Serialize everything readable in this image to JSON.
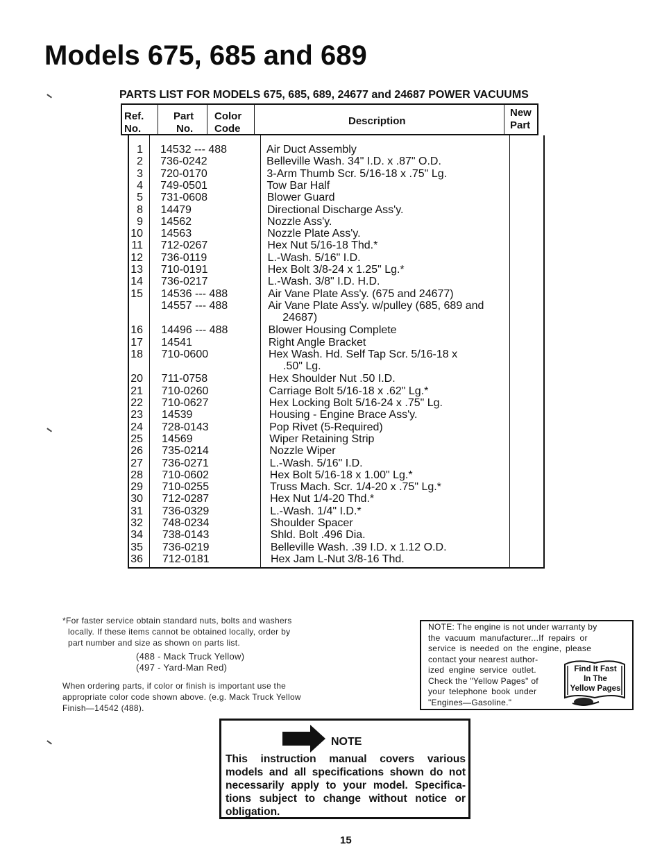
{
  "page": {
    "title": "Models 675, 685 and 689",
    "subtitle": "PARTS LIST FOR MODELS 675, 685, 689, 24677 and 24687 POWER VACUUMS",
    "page_number": "15"
  },
  "table": {
    "headers": {
      "ref": "Ref.\nNo.",
      "ref_line1": "Ref.",
      "ref_line2": "No.",
      "part_line1": "Part",
      "part_line2": "No.",
      "color_line1": "Color",
      "color_line2": "Code",
      "description": "Description",
      "new_line1": "New",
      "new_line2": "Part"
    },
    "rows": [
      {
        "ref": "1",
        "part": "14532 --- 488",
        "desc": "Air Duct Assembly"
      },
      {
        "ref": "2",
        "part": "736-0242",
        "desc": "Belleville Wash. 34\" I.D. x .87\" O.D."
      },
      {
        "ref": "3",
        "part": "720-0170",
        "desc": "3-Arm Thumb Scr. 5/16-18 x .75\" Lg."
      },
      {
        "ref": "4",
        "part": "749-0501",
        "desc": "Tow Bar Half"
      },
      {
        "ref": "5",
        "part": "731-0608",
        "desc": "Blower Guard"
      },
      {
        "ref": "8",
        "part": "14479",
        "desc": "Directional Discharge Ass'y."
      },
      {
        "ref": "9",
        "part": "14562",
        "desc": "Nozzle Ass'y."
      },
      {
        "ref": "10",
        "part": "14563",
        "desc": "Nozzle Plate Ass'y."
      },
      {
        "ref": "11",
        "part": "712-0267",
        "desc": "Hex Nut 5/16-18 Thd.*"
      },
      {
        "ref": "12",
        "part": "736-0119",
        "desc": "L.-Wash. 5/16\" I.D."
      },
      {
        "ref": "13",
        "part": "710-0191",
        "desc": "Hex Bolt 3/8-24 x 1.25\" Lg.*"
      },
      {
        "ref": "14",
        "part": "736-0217",
        "desc": "L.-Wash. 3/8\" I.D. H.D."
      },
      {
        "ref": "15",
        "part": "14536 --- 488",
        "desc": "Air Vane Plate Ass'y. (675 and 24677)"
      },
      {
        "ref": "",
        "part": "14557 --- 488",
        "desc": "Air Vane Plate Ass'y. w/pulley (685, 689 and",
        "desc_cont": "24687)"
      },
      {
        "ref": "16",
        "part": "14496 --- 488",
        "desc": "Blower Housing Complete"
      },
      {
        "ref": "17",
        "part": "14541",
        "desc": "Right Angle Bracket"
      },
      {
        "ref": "18",
        "part": "710-0600",
        "desc": "Hex Wash. Hd. Self Tap Scr. 5/16-18 x",
        "desc_cont": ".50\" Lg."
      },
      {
        "ref": "20",
        "part": "711-0758",
        "desc": "Hex Shoulder Nut .50 I.D."
      },
      {
        "ref": "21",
        "part": "710-0260",
        "desc": "Carriage Bolt 5/16-18 x .62\" Lg.*"
      },
      {
        "ref": "22",
        "part": "710-0627",
        "desc": "Hex Locking Bolt 5/16-24 x .75\" Lg."
      },
      {
        "ref": "23",
        "part": "14539",
        "desc": "Housing - Engine Brace Ass'y."
      },
      {
        "ref": "24",
        "part": "728-0143",
        "desc": "Pop Rivet (5-Required)"
      },
      {
        "ref": "25",
        "part": "14569",
        "desc": "Wiper Retaining Strip"
      },
      {
        "ref": "26",
        "part": "735-0214",
        "desc": "Nozzle Wiper"
      },
      {
        "ref": "27",
        "part": "736-0271",
        "desc": "L.-Wash. 5/16\" I.D."
      },
      {
        "ref": "28",
        "part": "710-0602",
        "desc": "Hex Bolt 5/16-18 x 1.00\" Lg.*"
      },
      {
        "ref": "29",
        "part": "710-0255",
        "desc": "Truss Mach. Scr. 1/4-20 x .75\" Lg.*"
      },
      {
        "ref": "30",
        "part": "712-0287",
        "desc": "Hex Nut 1/4-20 Thd.*"
      },
      {
        "ref": "31",
        "part": "736-0329",
        "desc": "L.-Wash. 1/4\" I.D.*"
      },
      {
        "ref": "32",
        "part": "748-0234",
        "desc": "Shoulder Spacer"
      },
      {
        "ref": "34",
        "part": "738-0143",
        "desc": "Shld. Bolt .496 Dia."
      },
      {
        "ref": "35",
        "part": "736-0219",
        "desc": "Belleville Wash. .39 I.D. x 1.12 O.D."
      },
      {
        "ref": "36",
        "part": "712-0181",
        "desc": "Hex Jam L-Nut 3/8-16 Thd."
      }
    ]
  },
  "footnotes": {
    "line1": "*For faster service obtain standard nuts, bolts and washers",
    "line2": "locally. If these items cannot be obtained locally, order by",
    "line3": "part number and size as shown on parts list.",
    "color_codes": [
      "(488 - Mack Truck Yellow)",
      "(497 - Yard-Man Red)"
    ],
    "ordering_line1": "When ordering parts, if color or finish is important use the",
    "ordering_line2": "appropriate color code shown above. (e.g. Mack Truck Yellow",
    "ordering_line3": "Finish—14542 (488)."
  },
  "engine_note": {
    "lines": [
      "NOTE: The engine is not under warranty by",
      "the vacuum manufacturer...If repairs or",
      "service is needed on the engine, please",
      "contact your nearest author-",
      "ized engine service outlet.",
      "Check the \"Yellow Pages\" of",
      "your telephone book under",
      "\"Engines—Gasoline.\""
    ],
    "badge_lines": [
      "Find It Fast",
      "In The",
      "Yellow Pages"
    ]
  },
  "manual_note": {
    "heading": "NOTE",
    "body": "This instruction manual covers various models and all specifications shown do not necessarily apply to your model. Specifica-tions subject to change without notice or obligation."
  }
}
